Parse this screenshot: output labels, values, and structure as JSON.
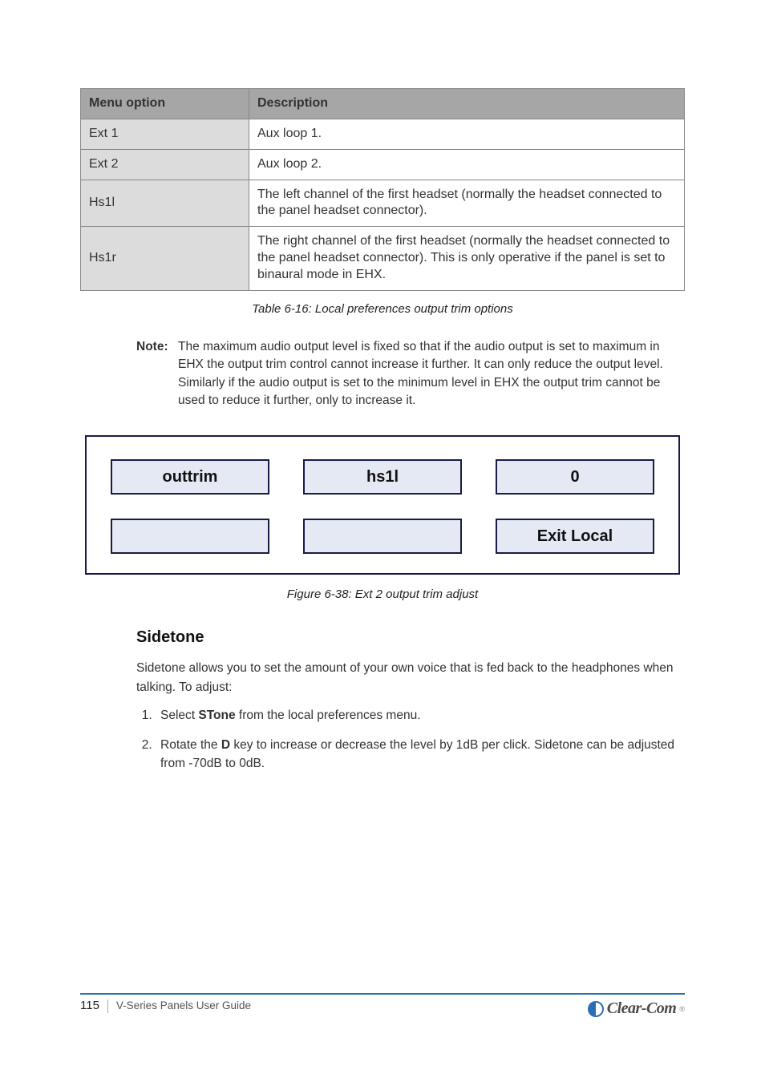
{
  "table": {
    "headers": [
      "Menu option",
      "Description"
    ],
    "rows": [
      {
        "label": "Ext 1",
        "val": "Aux loop 1."
      },
      {
        "label": "Ext 2",
        "val": "Aux loop 2."
      },
      {
        "label": "Hs1l",
        "val": "The left channel of the first headset (normally the headset connected to the panel headset connector)."
      },
      {
        "label": "Hs1r",
        "val": "The right channel of the first headset (normally the headset connected to the panel headset connector). This is only operative if the panel is set to binaural mode in EHX."
      }
    ]
  },
  "tableCaption": "Table 6-16: Local preferences output trim options",
  "note": {
    "label": "Note:",
    "text": "The maximum audio output level is fixed so that if the audio output is set to maximum in EHX the output trim control cannot increase it further. It can only reduce the output level. Similarly if the audio output is set to the minimum level in EHX the output trim cannot be used to reduce it further, only to increase it."
  },
  "menu": {
    "row1": [
      "outtrim",
      "hs1l",
      "0"
    ],
    "row2": [
      "",
      "",
      "Exit Local"
    ]
  },
  "menuCaption": "Figure 6-38: Ext 2 output trim adjust",
  "section": {
    "heading": "Sidetone",
    "intro": "Sidetone allows you to set the amount of your own voice that is fed back to the headphones when talking. To adjust:",
    "steps": [
      {
        "pre": "Select ",
        "b": "STone",
        "post": " from the local preferences menu."
      },
      {
        "pre": "Rotate the ",
        "b": "D",
        "post": " key to increase or decrease the level by 1dB per click. Sidetone can be adjusted from -70dB to 0dB."
      }
    ]
  },
  "footer": {
    "page": "115",
    "title": "V-Series Panels User Guide"
  },
  "logo": {
    "text": "Clear-Com"
  }
}
